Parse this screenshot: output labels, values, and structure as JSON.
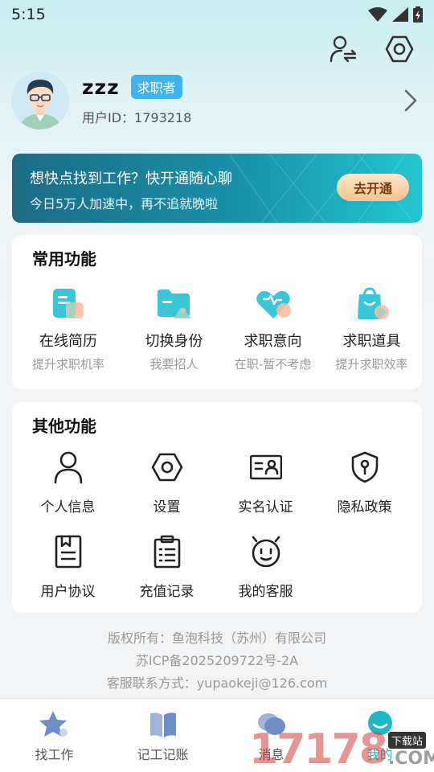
{
  "status_bar": {
    "time": "5:15"
  },
  "profile": {
    "name": "zzz",
    "role_badge": "求职者",
    "user_id": "用户ID：1793218"
  },
  "banner": {
    "title": "想快点找到工作？快开通随心聊",
    "subtitle": "今日5万人加速中，再不追就晚啦",
    "button": "去开通"
  },
  "common": {
    "title": "常用功能",
    "items": [
      {
        "label": "在线简历",
        "sub": "提升求职机率",
        "icon": "resume-icon"
      },
      {
        "label": "切换身份",
        "sub": "我要招人",
        "icon": "folder-switch-icon"
      },
      {
        "label": "求职意向",
        "sub": "在职-暂不考虑",
        "icon": "heart-icon"
      },
      {
        "label": "求职道具",
        "sub": "提升求职效率",
        "icon": "shopping-bag-icon"
      }
    ]
  },
  "other": {
    "title": "其他功能",
    "items": [
      {
        "label": "个人信息",
        "icon": "person-icon"
      },
      {
        "label": "设置",
        "icon": "settings-hexagon-icon"
      },
      {
        "label": "实名认证",
        "icon": "id-card-icon"
      },
      {
        "label": "隐私政策",
        "icon": "shield-icon"
      },
      {
        "label": "用户协议",
        "icon": "document-icon"
      },
      {
        "label": "充值记录",
        "icon": "clipboard-icon"
      },
      {
        "label": "我的客服",
        "icon": "support-robot-icon"
      }
    ]
  },
  "footer": {
    "copyright": "版权所有：鱼泡科技（苏州）有限公司",
    "icp": "苏ICP备2025209722号-2A",
    "contact": "客服联系方式：yupaokeji@126.com"
  },
  "tabs": [
    {
      "label": "找工作",
      "icon": "star-icon"
    },
    {
      "label": "记工记账",
      "icon": "book-icon"
    },
    {
      "label": "消息",
      "icon": "chat-bubble-icon"
    },
    {
      "label": "我的",
      "icon": "smile-face-icon"
    }
  ],
  "watermark": {
    "digits": "17178",
    "tag": "下载站",
    "suffix": ".COM"
  },
  "colors": {
    "accent": "#1fb6c6",
    "badge": "#3fb2ef",
    "banner_dark": "#1c6b86"
  }
}
